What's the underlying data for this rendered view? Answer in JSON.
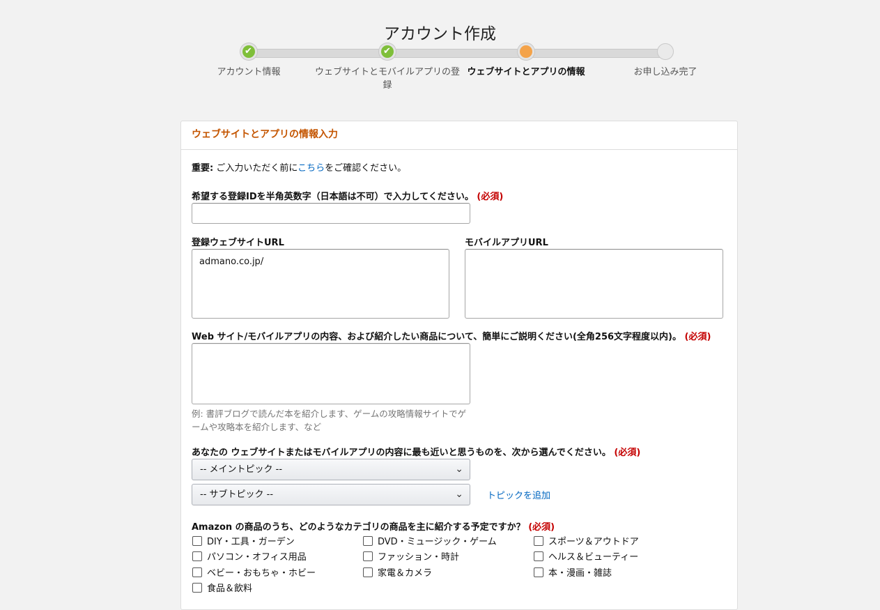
{
  "page": {
    "title": "アカウント作成"
  },
  "steps": [
    {
      "label": "アカウント情報",
      "state": "done"
    },
    {
      "label": "ウェブサイトとモバイルアプリの登録",
      "state": "done"
    },
    {
      "label": "ウェブサイトとアプリの情報",
      "state": "current"
    },
    {
      "label": "お申し込み完了",
      "state": "todo"
    }
  ],
  "card": {
    "title": "ウェブサイトとアプリの情報入力",
    "important_prefix": "重要:",
    "important_text_before": " ご入力いただく前に",
    "important_link": "こちら",
    "important_text_after": "をご確認ください。",
    "required_mark": "(必須)"
  },
  "fields": {
    "store_id_label": "希望する登録IDを半角英数字（日本語は不可）で入力してください。",
    "store_id_value": "",
    "website_url_label": "登録ウェブサイトURL",
    "website_url_value": "admano.co.jp/",
    "mobile_url_label": "モバイルアプリURL",
    "mobile_url_value": "",
    "description_label": "Web サイト/モバイルアプリの内容、および紹介したい商品について、簡単にご説明ください(全角256文字程度以内)。",
    "description_value": "",
    "description_hint_line1": "例: 書評ブログで読んだ本を紹介します、ゲームの攻略情報サイトでゲ",
    "description_hint_line2": "ームや攻略本を紹介します、など",
    "topic_label": "あなたの ウェブサイトまたはモバイルアプリの内容に最も近いと思うものを、次から選んでください。",
    "main_topic_selected": "-- メイントピック --",
    "sub_topic_selected": "-- サブトピック --",
    "add_topic_link": "トピックを追加",
    "category_label": "Amazon の商品のうち、どのようなカテゴリの商品を主に紹介する予定ですか？"
  },
  "categories": [
    {
      "label": "DIY・工具・ガーデン",
      "checked": false
    },
    {
      "label": "DVD・ミュージック・ゲーム",
      "checked": false
    },
    {
      "label": "スポーツ＆アウトドア",
      "checked": false
    },
    {
      "label": "パソコン・オフィス用品",
      "checked": false
    },
    {
      "label": "ファッション・時計",
      "checked": false
    },
    {
      "label": "ヘルス＆ビューティー",
      "checked": false
    },
    {
      "label": "ベビー・おもちゃ・ホビー",
      "checked": false
    },
    {
      "label": "家電＆カメラ",
      "checked": false
    },
    {
      "label": "本・漫画・雑誌",
      "checked": false
    },
    {
      "label": "食品＆飲料",
      "checked": false
    }
  ],
  "colors": {
    "accent": "#c45500",
    "link": "#0066c0",
    "required": "#c40000",
    "step_done": "#7fbf3a",
    "step_current": "#f4a34a"
  },
  "icons": {
    "step_done": "check-icon",
    "select": "chevron-down-icon"
  }
}
